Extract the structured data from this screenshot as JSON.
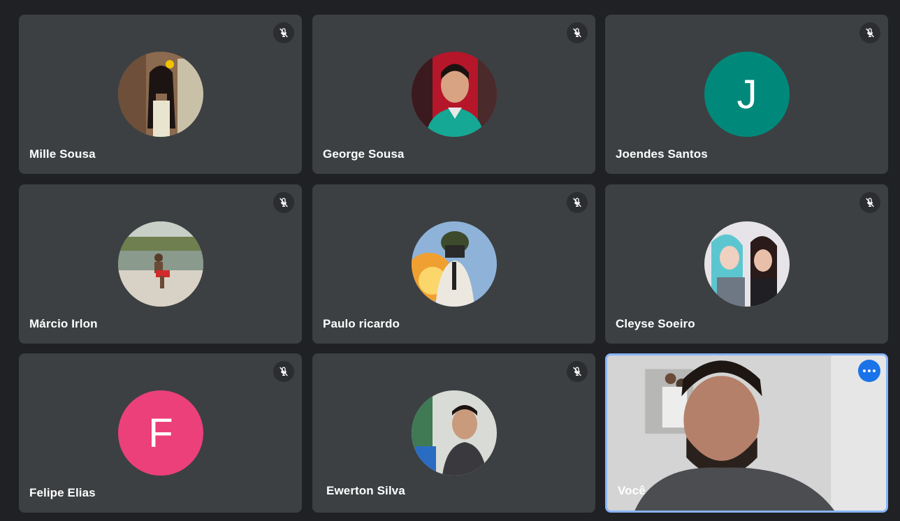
{
  "participants": [
    {
      "name": "Mille Sousa",
      "avatar": "photo",
      "muted": true
    },
    {
      "name": "George Sousa",
      "avatar": "photo",
      "muted": true
    },
    {
      "name": "Joendes Santos",
      "avatar": "letter",
      "letter": "J",
      "color": "#00897b",
      "muted": true
    },
    {
      "name": "Márcio Irlon",
      "avatar": "photo",
      "muted": true
    },
    {
      "name": "Paulo ricardo",
      "avatar": "photo",
      "muted": true
    },
    {
      "name": "Cleyse Soeiro",
      "avatar": "photo",
      "muted": true
    },
    {
      "name": "Felipe Elias",
      "avatar": "letter",
      "letter": "F",
      "color": "#ec407a",
      "muted": true
    },
    {
      "name": "Ewerton Silva",
      "avatar": "photo",
      "muted": true
    },
    {
      "name": "Você",
      "avatar": "video",
      "muted": false
    }
  ],
  "icons": {
    "muted": "mic-off-icon",
    "more": "more-options-icon"
  },
  "colors": {
    "background": "#202124",
    "tile": "#3c4043",
    "self_border": "#8ab4f8",
    "more_button": "#1a73e8"
  }
}
